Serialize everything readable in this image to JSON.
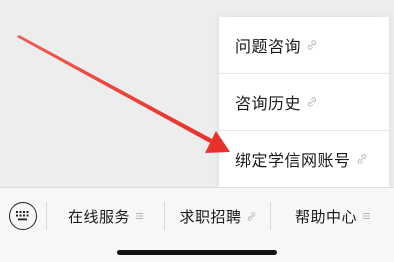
{
  "popup_menu": {
    "items": [
      {
        "label": "问题咨询",
        "icon": "link-icon"
      },
      {
        "label": "咨询历史",
        "icon": "link-icon"
      },
      {
        "label": "绑定学信网账号",
        "icon": "link-icon"
      }
    ]
  },
  "bottom_bar": {
    "keyboard_icon": "keyboard-icon",
    "tabs": [
      {
        "label": "在线服务",
        "icon": "menu-lines-icon"
      },
      {
        "label": "求职招聘",
        "icon": "link-icon"
      },
      {
        "label": "帮助中心",
        "icon": "menu-lines-icon"
      }
    ]
  },
  "annotation": {
    "arrow_color": "#e8312a",
    "arrow_target": "绑定学信网账号"
  },
  "colors": {
    "background": "#ededed",
    "menu_background": "#ffffff",
    "bar_background": "#f7f7f7",
    "text": "#1a1a1a",
    "icon_gray": "#b8b8b8"
  }
}
